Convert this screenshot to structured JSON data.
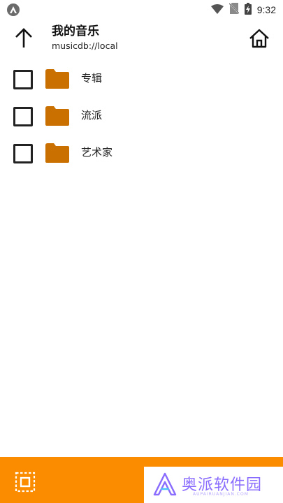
{
  "status_bar": {
    "time": "9:32",
    "icons": [
      "app-notification-icon",
      "wifi-icon",
      "no-sim-icon",
      "battery-icon"
    ]
  },
  "header": {
    "title": "我的音乐",
    "subtitle": "musicdb://local",
    "up_icon": "arrow-up-icon",
    "home_icon": "home-icon"
  },
  "folders": [
    {
      "label": "专辑",
      "checked": false,
      "icon": "folder-icon"
    },
    {
      "label": "流派",
      "checked": false,
      "icon": "folder-icon"
    },
    {
      "label": "艺术家",
      "checked": false,
      "icon": "folder-icon"
    }
  ],
  "bottom_bar": {
    "select_icon": "select-all-icon",
    "watermark_text": "奥派软件园",
    "watermark_url": "AUPAIRUANJIAN.COM"
  },
  "colors": {
    "accent": "#fb8c00",
    "folder": "#c97000",
    "watermark": "#8a6cff"
  }
}
